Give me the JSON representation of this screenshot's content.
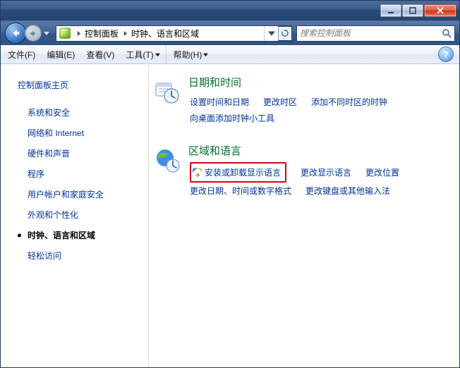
{
  "titlebar": {
    "minimize_btn": "minimize",
    "maximize_btn": "maximize",
    "close_btn": "close"
  },
  "breadcrumb": {
    "level1": "控制面板",
    "level2": "时钟、语言和区域"
  },
  "search": {
    "placeholder": "搜索控制面板"
  },
  "menu": {
    "file": "文件(F)",
    "edit": "编辑(E)",
    "view": "查看(V)",
    "tools": "工具(T)",
    "help": "帮助(H)"
  },
  "sidebar": {
    "home": "控制面板主页",
    "items": [
      "系统和安全",
      "网络和 Internet",
      "硬件和声音",
      "程序",
      "用户帐户和家庭安全",
      "外观和个性化",
      "时钟、语言和区域",
      "轻松访问"
    ],
    "current_index": 6
  },
  "sections": [
    {
      "title": "日期和时间",
      "links": [
        {
          "label": "设置时间和日期",
          "shield": false
        },
        {
          "label": "更改时区",
          "shield": false
        },
        {
          "label": "添加不同时区的时钟",
          "shield": false
        },
        {
          "label": "向桌面添加时钟小工具",
          "shield": false
        }
      ]
    },
    {
      "title": "区域和语言",
      "links": [
        {
          "label": "安装或卸载显示语言",
          "shield": true,
          "highlight": true
        },
        {
          "label": "更改显示语言",
          "shield": false
        },
        {
          "label": "更改位置",
          "shield": false
        },
        {
          "label": "更改日期、时间或数字格式",
          "shield": false
        },
        {
          "label": "更改键盘或其他输入法",
          "shield": false
        }
      ]
    }
  ]
}
